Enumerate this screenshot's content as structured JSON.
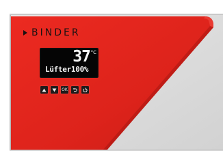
{
  "device": {
    "brand": "BINDER",
    "accent_color": "#e0261d",
    "panel_color": "#dcdcdc"
  },
  "display": {
    "temperature": "37",
    "unit": "°C",
    "status_line": "Lüfter100%"
  },
  "controls": {
    "up_icon": "triangle-up-icon",
    "down_icon": "triangle-down-icon",
    "ok_label": "OK",
    "back_icon": "return-arrow-icon",
    "power_icon": "power-icon"
  }
}
